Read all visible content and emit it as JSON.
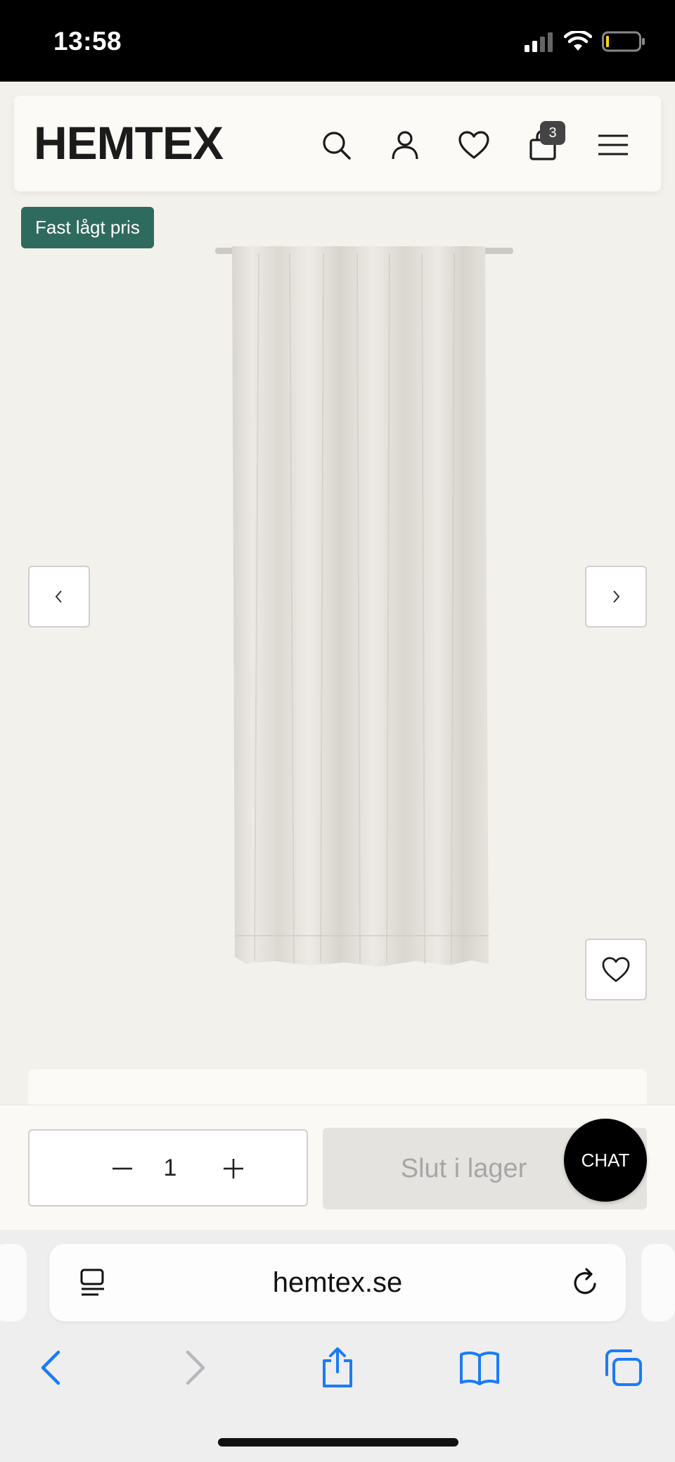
{
  "status_bar": {
    "time": "13:58"
  },
  "header": {
    "logo": "HEMTEX",
    "icons": [
      "search-icon",
      "account-icon",
      "heart-icon",
      "cart-icon",
      "menu-icon"
    ],
    "cart_count": "3"
  },
  "product": {
    "badge": "Fast lågt pris",
    "image_subject": "curtain-panel"
  },
  "purchase_bar": {
    "quantity": "1",
    "stock_button": "Slut i lager",
    "chat_button": "CHAT"
  },
  "browser": {
    "url": "hemtex.se"
  },
  "colors": {
    "badge_bg": "#2f6a5e",
    "page_bg": "#f3f1ec",
    "safari_blue": "#1a7cf5"
  }
}
